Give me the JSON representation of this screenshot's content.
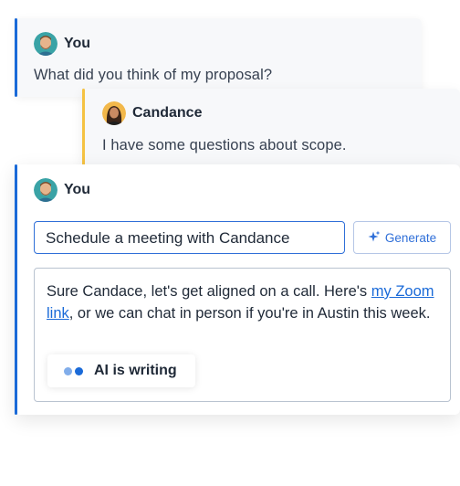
{
  "colors": {
    "you_accent": "#1a6ad8",
    "candance_accent": "#f5c242",
    "link": "#1a6ad8"
  },
  "messages": [
    {
      "sender": "You",
      "text": "What did you think of my proposal?"
    },
    {
      "sender": "Candance",
      "text": "I have some questions about scope."
    }
  ],
  "composer": {
    "sender": "You",
    "prompt_value": "Schedule a meeting with Candance",
    "generate_label": "Generate",
    "generate_icon": "sparkle-icon",
    "draft": {
      "before_link": "Sure Candace, let's get aligned on a call. Here's ",
      "link_text": "my Zoom link",
      "after_link": ", or we can chat in person if you're in Austin this week."
    },
    "status_label": "AI is writing"
  }
}
